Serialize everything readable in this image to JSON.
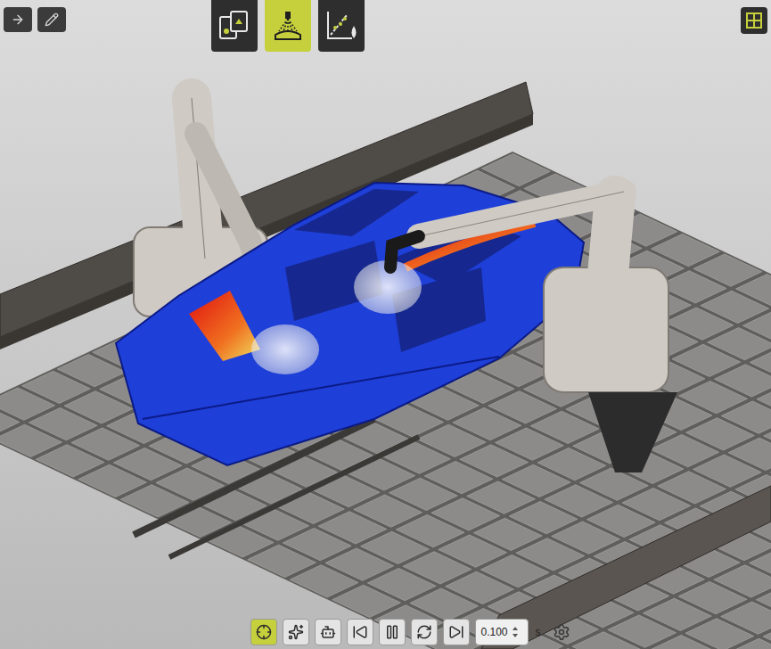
{
  "top_left_tools": [
    {
      "kind": "forward",
      "selected": false
    },
    {
      "kind": "edit",
      "selected": false
    }
  ],
  "mode_tabs": [
    {
      "kind": "setup",
      "selected": false
    },
    {
      "kind": "spray",
      "selected": true
    },
    {
      "kind": "analysis",
      "selected": false
    }
  ],
  "layout_button": {
    "kind": "grid",
    "selected": false
  },
  "bottom_toolbar": [
    {
      "kind": "target",
      "selected": true
    },
    {
      "kind": "spark",
      "selected": false
    },
    {
      "kind": "robot",
      "selected": false
    },
    {
      "kind": "skip-back",
      "selected": false
    },
    {
      "kind": "pause",
      "selected": false
    },
    {
      "kind": "loop",
      "selected": false
    },
    {
      "kind": "skip-forward",
      "selected": false
    }
  ],
  "time_step": {
    "value": "0.100",
    "unit": "s"
  }
}
